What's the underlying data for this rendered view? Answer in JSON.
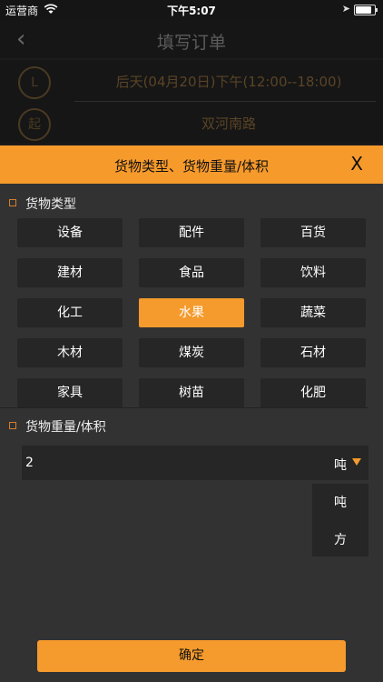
{
  "status_bar": {
    "carrier": "运营商",
    "time": "下午5:07",
    "location_icon": "location-arrow-icon",
    "battery_icon": "battery-icon",
    "wifi_icon": "wifi-icon"
  },
  "nav": {
    "title": "填写订单",
    "back_icon": "chevron-left-icon"
  },
  "order": {
    "time_icon_label": "L",
    "time_text": "后天(04月20日)下午(12:00--18:00)",
    "start_icon_label": "起",
    "start_text": "双河南路"
  },
  "modal": {
    "title": "货物类型、货物重量/体积",
    "close_label": "X",
    "cargo_type": {
      "label": "货物类型",
      "options": [
        "设备",
        "配件",
        "百货",
        "建材",
        "食品",
        "饮料",
        "化工",
        "水果",
        "蔬菜",
        "木材",
        "煤炭",
        "石材",
        "家具",
        "树苗",
        "化肥"
      ],
      "selected": "水果"
    },
    "weight": {
      "label": "货物重量/体积",
      "value": "2",
      "unit": "吨",
      "unit_options": [
        "吨",
        "方"
      ]
    },
    "confirm_label": "确定"
  },
  "colors": {
    "accent": "#f59a2c",
    "panel": "#323232",
    "cell": "#262626"
  }
}
